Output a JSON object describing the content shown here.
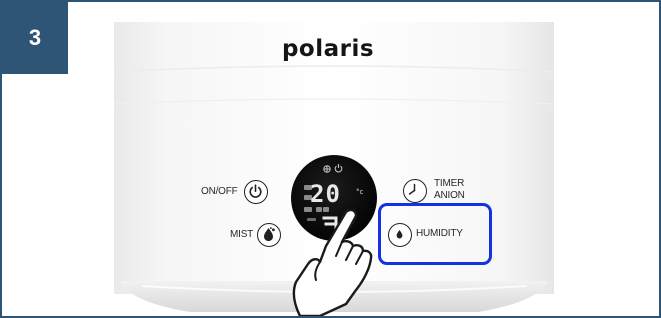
{
  "step": {
    "number": "3"
  },
  "device": {
    "brand": "polaris",
    "display": {
      "temperature": "20",
      "unit": "°c"
    },
    "buttons": {
      "onoff": {
        "label": "ON/OFF",
        "icon": "power-icon"
      },
      "mist": {
        "label": "MIST",
        "icon": "mist-drop-icon"
      },
      "timer": {
        "label_line1": "TIMER",
        "label_line2": "ANION",
        "icon": "clock-icon"
      },
      "humidity": {
        "label": "HUMIDITY",
        "icon": "humidity-cycle-icon"
      }
    }
  },
  "highlight": {
    "color": "#1432e0",
    "target": "humidity-button"
  },
  "colors": {
    "badge": "#2f5576",
    "frame_border": "#2f5576"
  }
}
